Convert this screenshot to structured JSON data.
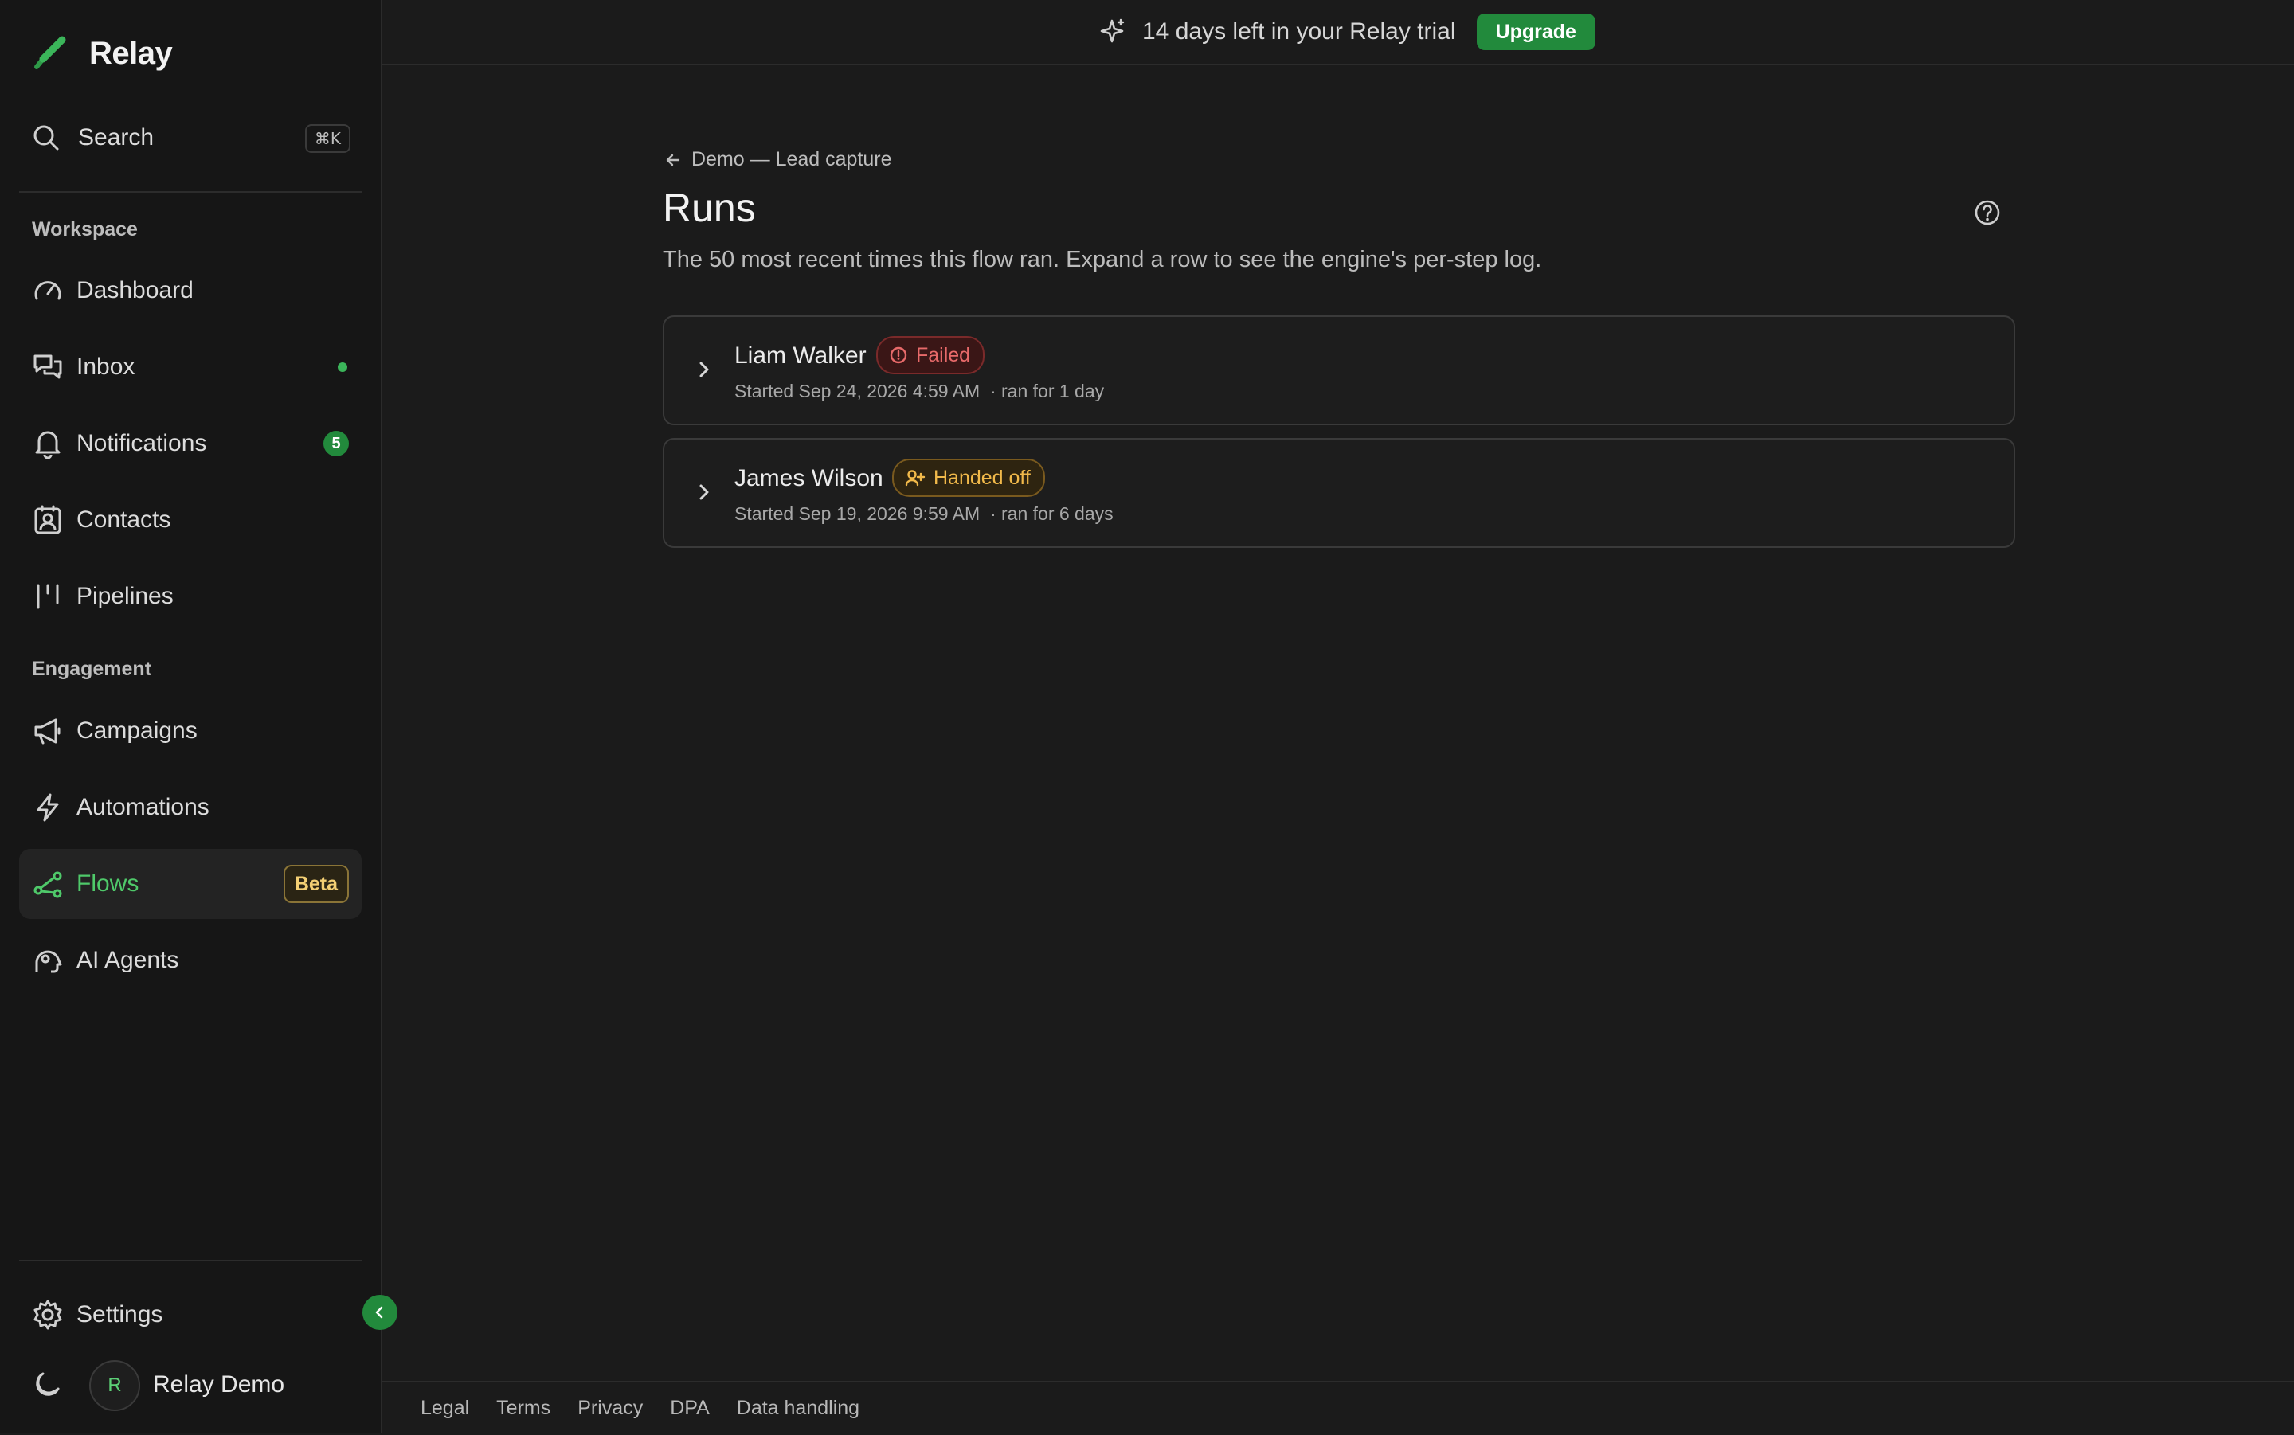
{
  "app": {
    "name": "Relay"
  },
  "sidebar": {
    "search": {
      "label": "Search",
      "shortcut": "⌘K"
    },
    "sections": {
      "workspace": "Workspace",
      "engagement": "Engagement"
    },
    "items": [
      {
        "label": "Dashboard",
        "icon": "gauge-icon"
      },
      {
        "label": "Inbox",
        "icon": "inbox-chat-icon",
        "indicator": "dot"
      },
      {
        "label": "Notifications",
        "icon": "bell-icon",
        "count": "5"
      },
      {
        "label": "Contacts",
        "icon": "contacts-icon"
      },
      {
        "label": "Pipelines",
        "icon": "pipeline-icon"
      },
      {
        "label": "Campaigns",
        "icon": "megaphone-icon"
      },
      {
        "label": "Automations",
        "icon": "lightning-icon"
      },
      {
        "label": "Flows",
        "icon": "flow-icon",
        "badge": "Beta",
        "active": true
      },
      {
        "label": "AI Agents",
        "icon": "ai-brain-icon"
      }
    ],
    "settings": "Settings",
    "user": {
      "initial": "R",
      "name": "Relay Demo"
    }
  },
  "banner": {
    "text": "14 days left in your Relay trial",
    "cta": "Upgrade"
  },
  "main": {
    "breadcrumb": "Demo — Lead capture",
    "title": "Runs",
    "subtitle": "The 50 most recent times this flow ran. Expand a row to see the engine's per-step log.",
    "runs": [
      {
        "name": "Liam Walker",
        "status": "Failed",
        "started": "Started Sep 24, 2026 4:59 AM",
        "duration": "· ran for 1 day"
      },
      {
        "name": "James Wilson",
        "status": "Handed off",
        "started": "Started Sep 19, 2026 9:59 AM",
        "duration": "· ran for 6 days"
      }
    ]
  },
  "footer": {
    "links": [
      "Legal",
      "Terms",
      "Privacy",
      "DPA",
      "Data handling"
    ]
  },
  "colors": {
    "accent": "#228a3c",
    "accent_text": "#4fc96a",
    "failed": "#e86a6a",
    "handed_off": "#f1b94a",
    "background": "#1b1b1b"
  }
}
